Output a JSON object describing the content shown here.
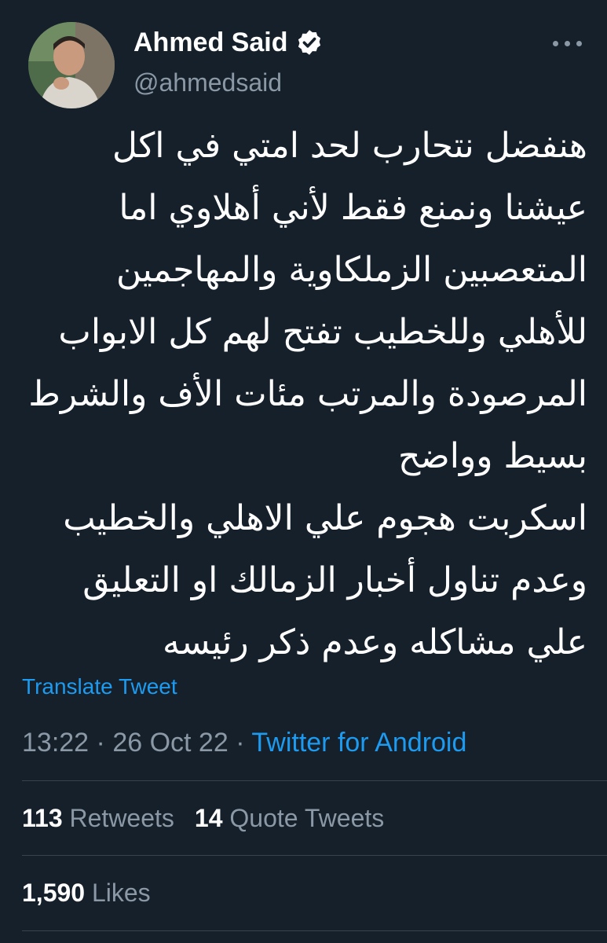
{
  "author": {
    "display_name": "Ahmed Said",
    "handle": "@ahmedsaid",
    "verified": true
  },
  "tweet": {
    "lines": [
      "هنفضل نتحارب لحد امتي في اكل",
      "عيشنا ونمنع فقط لأني أهلاوي اما",
      "المتعصبين الزملكاوية والمهاجمين",
      "للأهلي وللخطيب تفتح لهم كل الابواب",
      "المرصودة والمرتب مئات الأف والشرط",
      "بسيط وواضح",
      "اسكربت هجوم علي الاهلي والخطيب",
      "وعدم تناول أخبار الزمالك او التعليق",
      "علي مشاكله وعدم ذكر رئيسه"
    ],
    "translate_label": "Translate Tweet",
    "time": "13:22",
    "date": "26 Oct 22",
    "separator": "·",
    "source": "Twitter for Android"
  },
  "stats": {
    "retweets_count": "113",
    "retweets_label": "Retweets",
    "quotes_count": "14",
    "quotes_label": "Quote Tweets",
    "likes_count": "1,590",
    "likes_label": "Likes"
  },
  "colors": {
    "background": "#15202b",
    "accent": "#1d9bf0",
    "secondary_text": "#8b98a5",
    "divider": "#38444d"
  },
  "icons": {
    "verified": "verified-badge-icon",
    "more": "more-options-icon"
  }
}
